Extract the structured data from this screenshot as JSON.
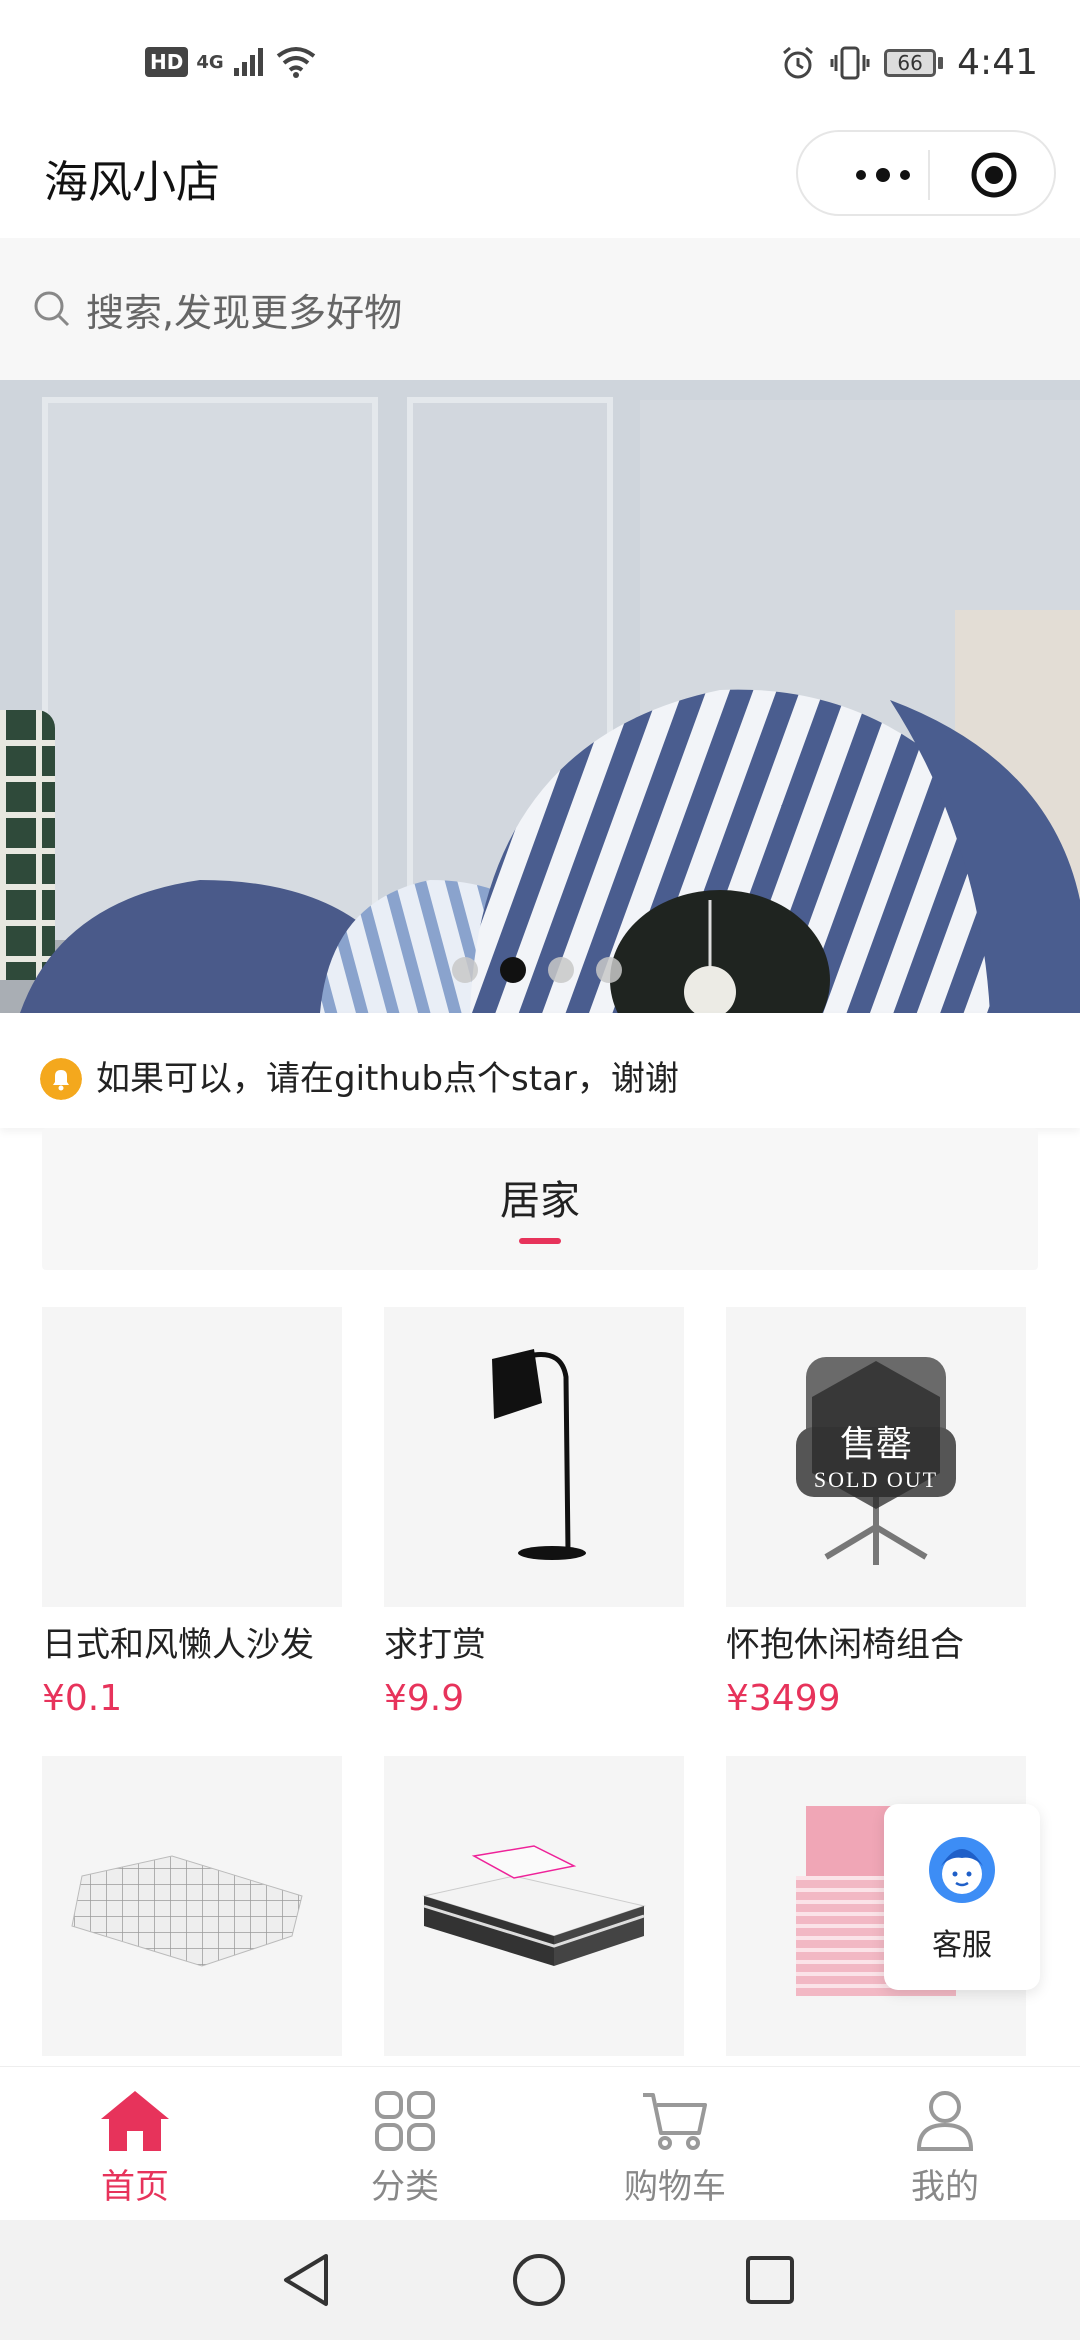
{
  "status_bar": {
    "hd": "HD",
    "network": "4G",
    "battery": "66",
    "time": "4:41"
  },
  "header": {
    "title": "海风小店"
  },
  "search": {
    "placeholder": "搜索,发现更多好物"
  },
  "banner": {
    "slide_count": 4,
    "active_index": 1
  },
  "notice": {
    "text": "如果可以，请在github点个star，谢谢"
  },
  "category": {
    "title": "居家"
  },
  "products": [
    {
      "name": "日式和风懒人沙发",
      "price": "¥0.1"
    },
    {
      "name": "求打赏",
      "price": "¥9.9"
    },
    {
      "name": "怀抱休闲椅组合",
      "price": "¥3499",
      "sold_out_cn": "售罄",
      "sold_out_en": "SOLD OUT"
    },
    {
      "name": "",
      "price": ""
    },
    {
      "name": "",
      "price": ""
    },
    {
      "name": "",
      "price": ""
    }
  ],
  "service": {
    "label": "客服"
  },
  "tabbar": {
    "home": "首页",
    "category": "分类",
    "cart": "购物车",
    "mine": "我的"
  },
  "colors": {
    "accent": "#e7335b",
    "notice": "#f4a81d"
  }
}
